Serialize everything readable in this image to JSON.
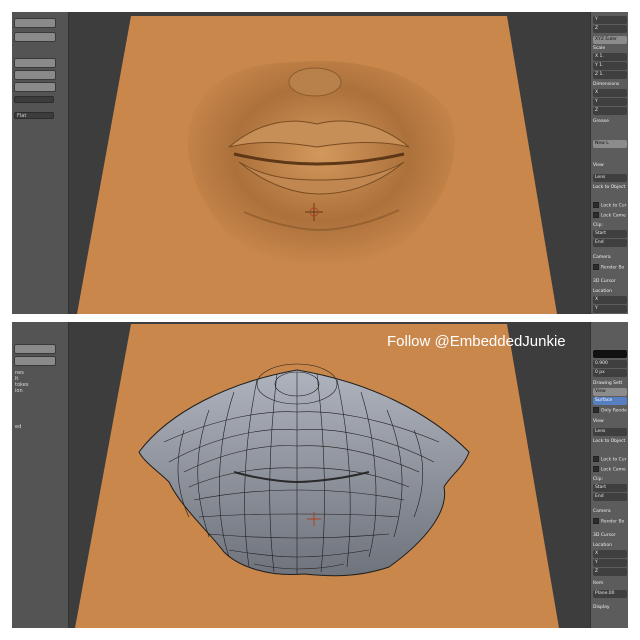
{
  "watermark": "Follow @EmbeddedJunkie",
  "colors": {
    "viewport_bg": "#3d3d3d",
    "plane": "#c9874b",
    "sculpt": "#b07840",
    "mesh": "#8a8f99",
    "accent": "#5680c2"
  },
  "top_toolshelf": {
    "field_values": [
      "Flat"
    ]
  },
  "bottom_toolshelf": {
    "labels": [
      "nes",
      "lt",
      "tokes",
      "ion",
      "ed"
    ]
  },
  "top_props": {
    "rows": [
      "Y",
      "Z",
      "XYZ Euler",
      "Scale",
      "X 1.",
      "Y 1.",
      "Z 1.",
      "Dimensions",
      "X",
      "Y",
      "Z",
      "Grease",
      "New L",
      "View",
      "Lens",
      "Lock to Object",
      "Lock to Cur",
      "Lock Came",
      "Clip:",
      "Start",
      "End",
      "Camera",
      "Render Bo",
      "3D Cursor",
      "Location",
      "X",
      "Y"
    ]
  },
  "bottom_props": {
    "rows": [
      "0.900",
      "0 px",
      "Drawing Sett",
      "View",
      "Surface",
      "Only Rende",
      "View",
      "Lens",
      "Lock to Object",
      "Lock to Cur",
      "Lock Came",
      "Clip:",
      "Start",
      "End",
      "Camera",
      "Render Bo",
      "3D Cursor",
      "Location",
      "X",
      "Y",
      "Z",
      "Item",
      "Plane.00",
      "Display"
    ]
  }
}
